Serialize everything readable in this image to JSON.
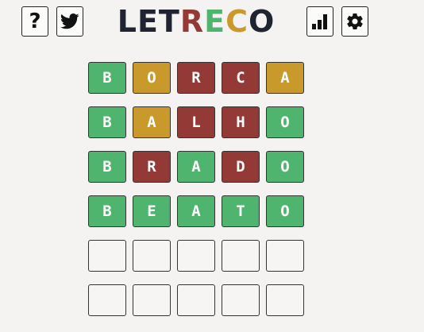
{
  "header": {
    "help_label": "?",
    "icons": {
      "help": "question-mark-icon",
      "twitter": "twitter-bird-icon",
      "stats": "bar-chart-icon",
      "settings": "gear-icon"
    },
    "logo_letters": [
      {
        "char": "L",
        "color": "#1f2430"
      },
      {
        "char": "E",
        "color": "#1f2430"
      },
      {
        "char": "T",
        "color": "#1f2430"
      },
      {
        "char": "R",
        "color": "#943a36"
      },
      {
        "char": "E",
        "color": "#4fb56e"
      },
      {
        "char": "C",
        "color": "#c99a2b"
      },
      {
        "char": "O",
        "color": "#1f2430"
      }
    ]
  },
  "colors": {
    "correct": "#4fb56e",
    "present": "#c99a2b",
    "absent": "#943a36",
    "background": "#f4f3f2"
  },
  "board": {
    "rows": [
      [
        {
          "letter": "B",
          "state": "correct"
        },
        {
          "letter": "O",
          "state": "present"
        },
        {
          "letter": "R",
          "state": "absent"
        },
        {
          "letter": "C",
          "state": "absent"
        },
        {
          "letter": "A",
          "state": "present"
        }
      ],
      [
        {
          "letter": "B",
          "state": "correct"
        },
        {
          "letter": "A",
          "state": "present"
        },
        {
          "letter": "L",
          "state": "absent"
        },
        {
          "letter": "H",
          "state": "absent"
        },
        {
          "letter": "O",
          "state": "correct"
        }
      ],
      [
        {
          "letter": "B",
          "state": "correct"
        },
        {
          "letter": "R",
          "state": "absent"
        },
        {
          "letter": "A",
          "state": "correct"
        },
        {
          "letter": "D",
          "state": "absent"
        },
        {
          "letter": "O",
          "state": "correct"
        }
      ],
      [
        {
          "letter": "B",
          "state": "correct"
        },
        {
          "letter": "E",
          "state": "correct"
        },
        {
          "letter": "A",
          "state": "correct"
        },
        {
          "letter": "T",
          "state": "correct"
        },
        {
          "letter": "O",
          "state": "correct"
        }
      ],
      [
        {
          "letter": "",
          "state": "empty"
        },
        {
          "letter": "",
          "state": "empty"
        },
        {
          "letter": "",
          "state": "empty"
        },
        {
          "letter": "",
          "state": "empty"
        },
        {
          "letter": "",
          "state": "empty"
        }
      ],
      [
        {
          "letter": "",
          "state": "empty"
        },
        {
          "letter": "",
          "state": "empty"
        },
        {
          "letter": "",
          "state": "empty"
        },
        {
          "letter": "",
          "state": "empty"
        },
        {
          "letter": "",
          "state": "empty"
        }
      ]
    ]
  }
}
